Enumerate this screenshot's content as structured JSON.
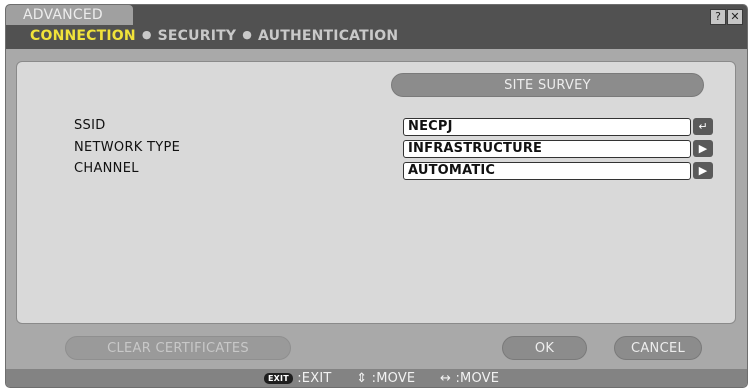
{
  "window": {
    "title": "ADVANCED",
    "help_icon_glyph": "?",
    "close_icon_glyph": "✕"
  },
  "tabs": [
    {
      "label": "CONNECTION",
      "active": true
    },
    {
      "label": "SECURITY",
      "active": false
    },
    {
      "label": "AUTHENTICATION",
      "active": false
    }
  ],
  "tab_separator": "●",
  "panel": {
    "site_survey_label": "SITE SURVEY",
    "fields": [
      {
        "label": "SSID",
        "value": "NECPJ",
        "button_icon": "enter-icon",
        "button_glyph": "↵"
      },
      {
        "label": "NETWORK TYPE",
        "value": "INFRASTRUCTURE",
        "button_icon": "arrow-right-icon",
        "button_glyph": "▶"
      },
      {
        "label": "CHANNEL",
        "value": "AUTOMATIC",
        "button_icon": "arrow-right-icon",
        "button_glyph": "▶"
      }
    ]
  },
  "buttons": {
    "clear_certificates": "CLEAR CERTIFICATES",
    "ok": "OK",
    "cancel": "CANCEL"
  },
  "footer": {
    "exit_key": "EXIT",
    "exit_text": ":EXIT",
    "move_vertical_glyph": "⇕",
    "move_vertical_text": ":MOVE",
    "move_horizontal_glyph": "↔",
    "move_horizontal_text": ":MOVE"
  },
  "colors": {
    "active_tab": "#f1e33a",
    "inactive_tab": "#c9c9c9",
    "topbar": "#515151",
    "panel": "#d9d9d9",
    "pill_button": "#8c8c8c"
  }
}
